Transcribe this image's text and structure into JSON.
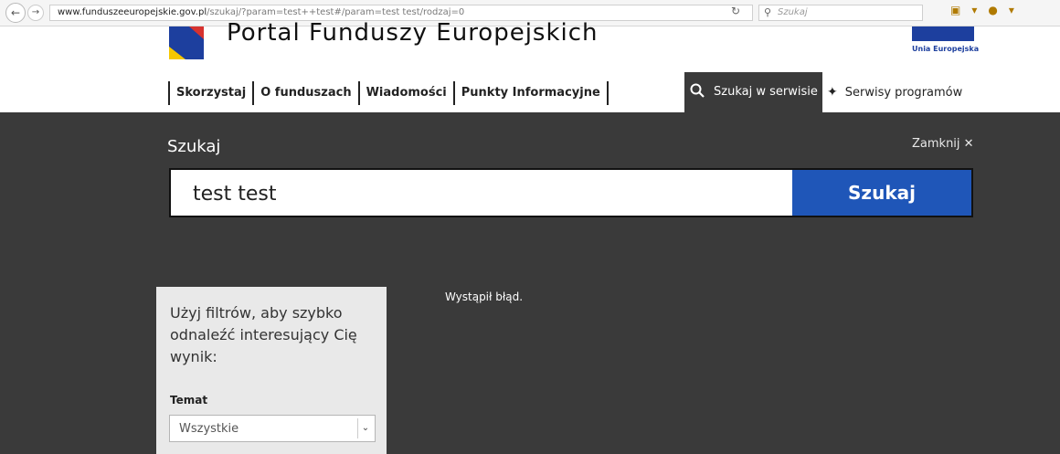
{
  "browser": {
    "url_domain": "www.funduszeeuropejskie.gov.pl",
    "url_path": "/szukaj/?param=test++test#/param=test test/rodzaj=0",
    "search_placeholder": "Szukaj"
  },
  "header": {
    "portal_title": "Portal Funduszy Europejskich",
    "eu_label": "Unia Europejska"
  },
  "nav": {
    "items": [
      "Skorzystaj",
      "O funduszach",
      "Wiadomości",
      "Punkty Informacyjne"
    ],
    "search_tab": "Szukaj w serwisie",
    "services": "Serwisy programów"
  },
  "search_panel": {
    "title": "Szukaj",
    "close": "Zamknij ✕",
    "query": "test test",
    "button": "Szukaj",
    "error": "Wystąpił błąd."
  },
  "filters": {
    "intro": "Użyj filtrów, aby szybko odnaleźć interesujący Cię wynik:",
    "topic_label": "Temat",
    "topic_value": "Wszystkie"
  }
}
